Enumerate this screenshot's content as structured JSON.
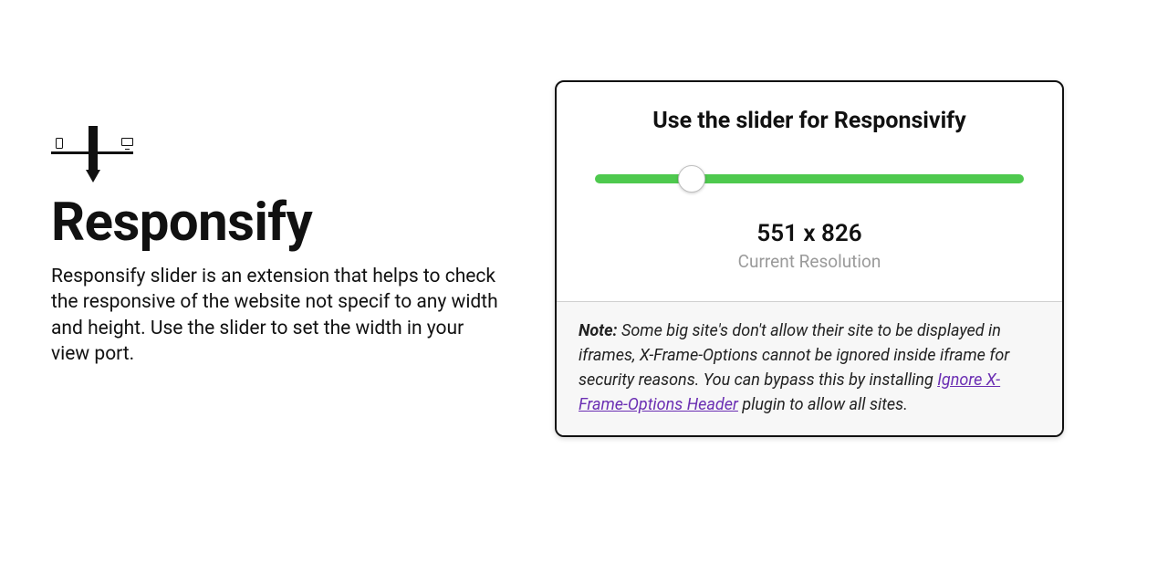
{
  "left": {
    "title": "Responsify",
    "description": "Responsify slider is an extension that helps to check the responsive of the website not specif to any width and height. Use the slider to set the width in your view port."
  },
  "card": {
    "title": "Use the slider for Responsivify",
    "slider": {
      "position_percent": 22.5
    },
    "resolution_text": "551 x 826",
    "resolution_label": "Current Resolution",
    "note": {
      "label": "Note:",
      "text_before": " Some big site's don't allow their site to be displayed in iframes, X-Frame-Options cannot be ignored inside iframe for security reasons. You can bypass this by installing ",
      "link_text": "Ignore X-Frame-Options Header",
      "text_after": " plugin to allow all sites."
    }
  },
  "colors": {
    "slider_track": "#4ec94e",
    "link": "#6b2fb3"
  }
}
